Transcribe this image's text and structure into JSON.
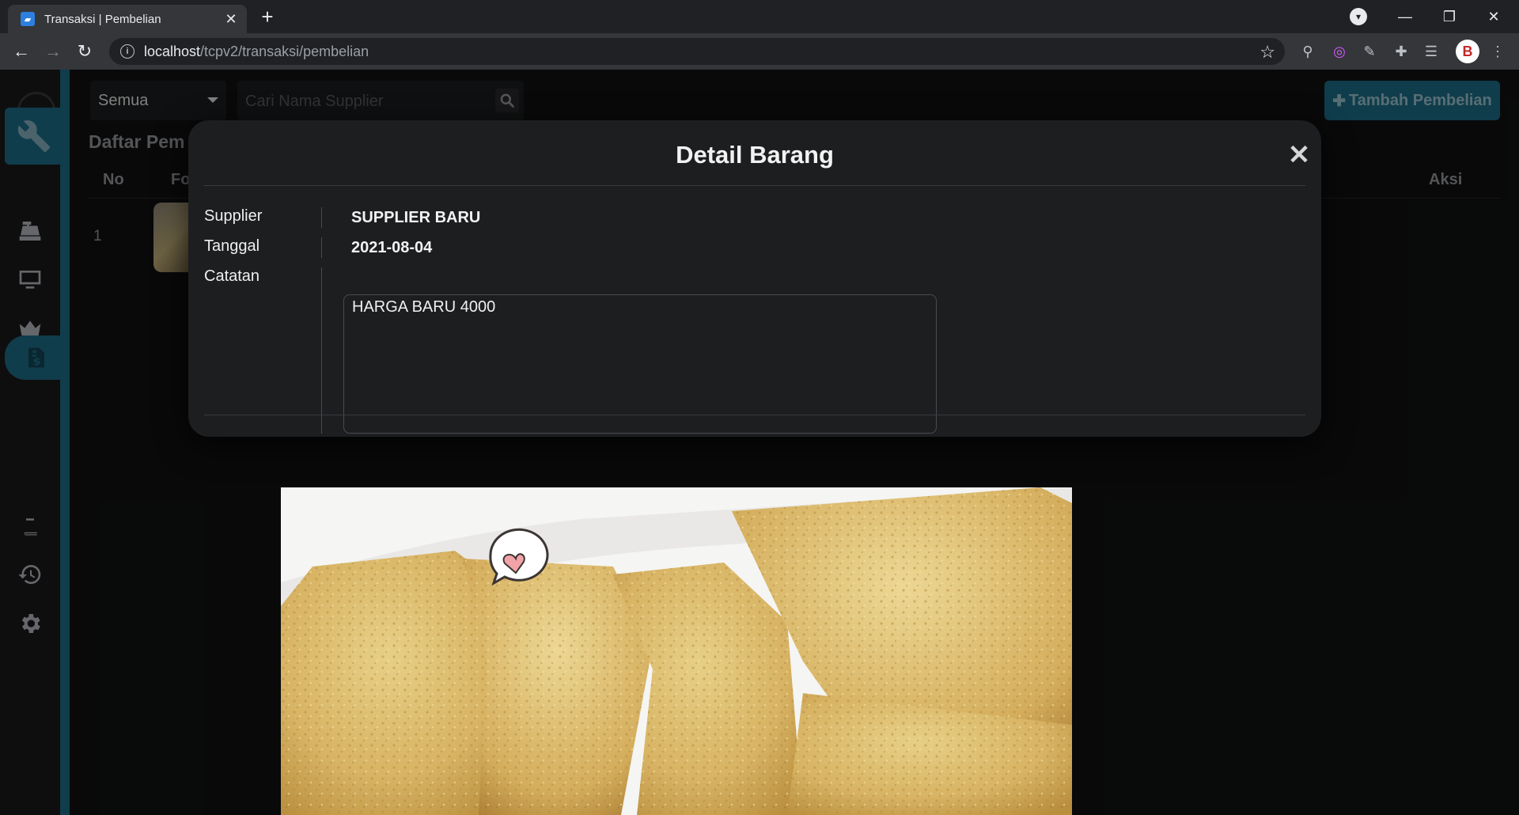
{
  "browser": {
    "tab_title": "Transaksi | Pembelian",
    "url_host": "localhost",
    "url_path": "/tcpv2/transaksi/pembelian",
    "profile_letter": "B"
  },
  "toolbar": {
    "filter_value": "Semua",
    "search_placeholder": "Cari Nama Supplier",
    "add_label": "Tambah Pembelian"
  },
  "list": {
    "title": "Daftar Pem",
    "columns": {
      "no": "No",
      "foto": "Fo",
      "aksi": "Aksi"
    },
    "rows": [
      {
        "no": "1"
      }
    ]
  },
  "modal": {
    "title": "Detail Barang",
    "close_symbol": "✕",
    "fields": {
      "supplier_label": "Supplier",
      "supplier_value": "SUPPLIER BARU",
      "tanggal_label": "Tanggal",
      "tanggal_value": "2021-08-04",
      "catatan_label": "Catatan",
      "catatan_value": "HARGA BARU 4000"
    }
  },
  "colors": {
    "accent": "#1e6f8a",
    "background": "#111213",
    "panel": "#1d1e20"
  }
}
